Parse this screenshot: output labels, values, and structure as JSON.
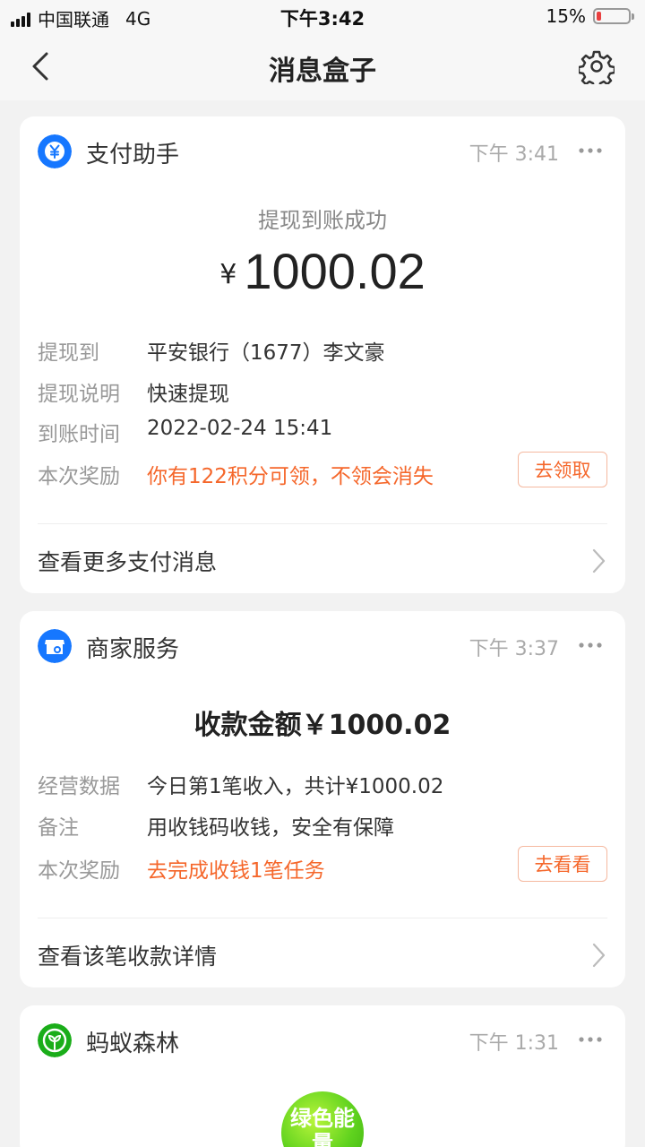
{
  "status_bar": {
    "carrier": "中国联通",
    "network": "4G",
    "time": "下午3:42",
    "battery": "15%",
    "battery_level": 0.15
  },
  "nav": {
    "title": "消息盒子",
    "back_icon": "chevron-left-icon",
    "settings_icon": "gear-icon"
  },
  "cards": [
    {
      "app_name": "支付助手",
      "icon": "yen-coin-icon",
      "icon_color": "#1677ff",
      "time": "下午 3:41",
      "headline": "提现到账成功",
      "currency": "¥",
      "amount": "1000.02",
      "rows": [
        {
          "label": "提现到",
          "value": "平安银行（1677）李文豪"
        },
        {
          "label": "提现说明",
          "value": "快速提现"
        },
        {
          "label": "到账时间",
          "value": "2022-02-24 15:41"
        },
        {
          "label": "本次奖励",
          "value": "你有122积分可领，不领会消失",
          "button": "去领取"
        }
      ],
      "footer": "查看更多支付消息"
    },
    {
      "app_name": "商家服务",
      "icon": "store-icon",
      "icon_color": "#1677ff",
      "time": "下午 3:37",
      "headline": "收款金额￥1000.02",
      "rows": [
        {
          "label": "经营数据",
          "value": "今日第1笔收入，共计¥1000.02"
        },
        {
          "label": "备注",
          "value": "用收钱码收钱，安全有保障"
        },
        {
          "label": "本次奖励",
          "value": "去完成收钱1笔任务",
          "button": "去看看"
        }
      ],
      "footer": "查看该笔收款详情"
    },
    {
      "app_name": "蚂蚁森林",
      "icon": "sprout-icon",
      "icon_color": "#1aad19",
      "time": "下午 1:31",
      "energy_label": "绿色能量"
    }
  ],
  "colors": {
    "accent_orange": "#f5672b",
    "background": "#f2f2f2"
  }
}
